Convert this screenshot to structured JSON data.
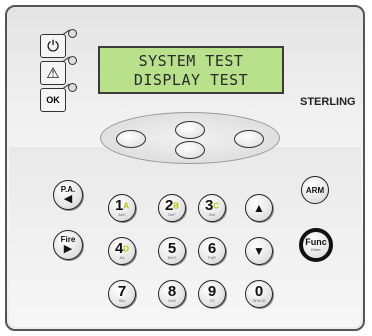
{
  "device": {
    "brand": "STERLING",
    "panel_color": "#efefef",
    "lcd_color": "#b9e08a"
  },
  "display": {
    "line1": "SYSTEM TEST",
    "line2": "DISPLAY TEST"
  },
  "indicators": [
    {
      "name": "power-icon",
      "glyph": "⏻"
    },
    {
      "name": "warning-icon",
      "glyph": "⚠"
    },
    {
      "name": "ok-icon",
      "glyph": "OK"
    }
  ],
  "left_keys": {
    "pa": {
      "label": "P.A.",
      "arrow": "◀"
    },
    "fire": {
      "label": "Fire",
      "arrow": "▶"
    }
  },
  "keypad": [
    {
      "num": "1",
      "lit": "A",
      "sub": "AbC"
    },
    {
      "num": "2",
      "lit": "B",
      "sub": "DeF"
    },
    {
      "num": "3",
      "lit": "C",
      "sub": "GhI"
    },
    {
      "num": "4",
      "lit": "D",
      "sub": "JkL"
    },
    {
      "num": "5",
      "lit": "",
      "sub": "MnO"
    },
    {
      "num": "6",
      "lit": "",
      "sub": "PqR"
    },
    {
      "num": "7",
      "lit": "",
      "sub": "StU"
    },
    {
      "num": "8",
      "lit": "",
      "sub": "VwX"
    },
    {
      "num": "9",
      "lit": "",
      "sub": "YZ"
    },
    {
      "num": "0",
      "lit": "",
      "sub": "SPACE"
    }
  ],
  "arrows": {
    "up": "▲",
    "down": "▼"
  },
  "right_keys": {
    "arm": "ARM",
    "func": "Func",
    "func_sub": "Enter"
  }
}
